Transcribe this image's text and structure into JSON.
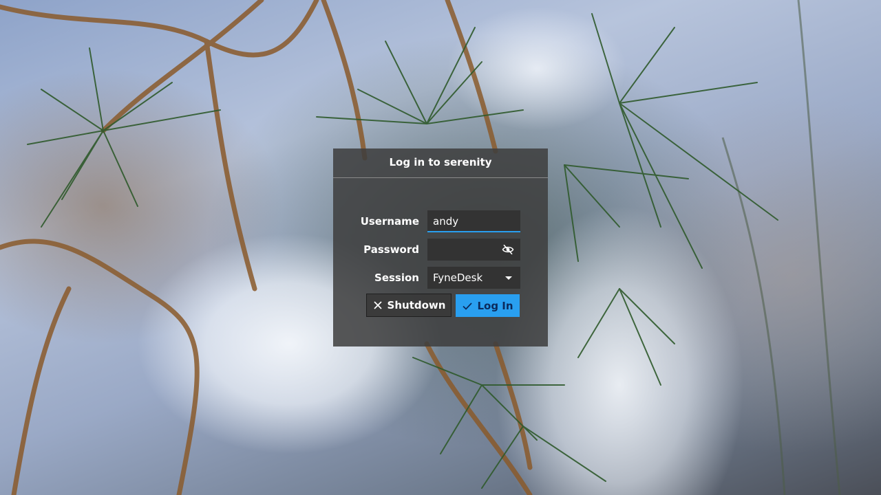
{
  "dialog": {
    "title": "Log in to serenity"
  },
  "form": {
    "username_label": "Username",
    "username_value": "andy",
    "password_label": "Password",
    "password_value": "",
    "session_label": "Session",
    "session_value": "FyneDesk"
  },
  "buttons": {
    "shutdown_label": "Shutdown",
    "shutdown_icon": "close-icon",
    "login_label": "Log In",
    "login_icon": "check-icon"
  },
  "colors": {
    "accent": "#299ff0",
    "dialog_bg": "#3e3e3e",
    "text": "#ffffff"
  }
}
